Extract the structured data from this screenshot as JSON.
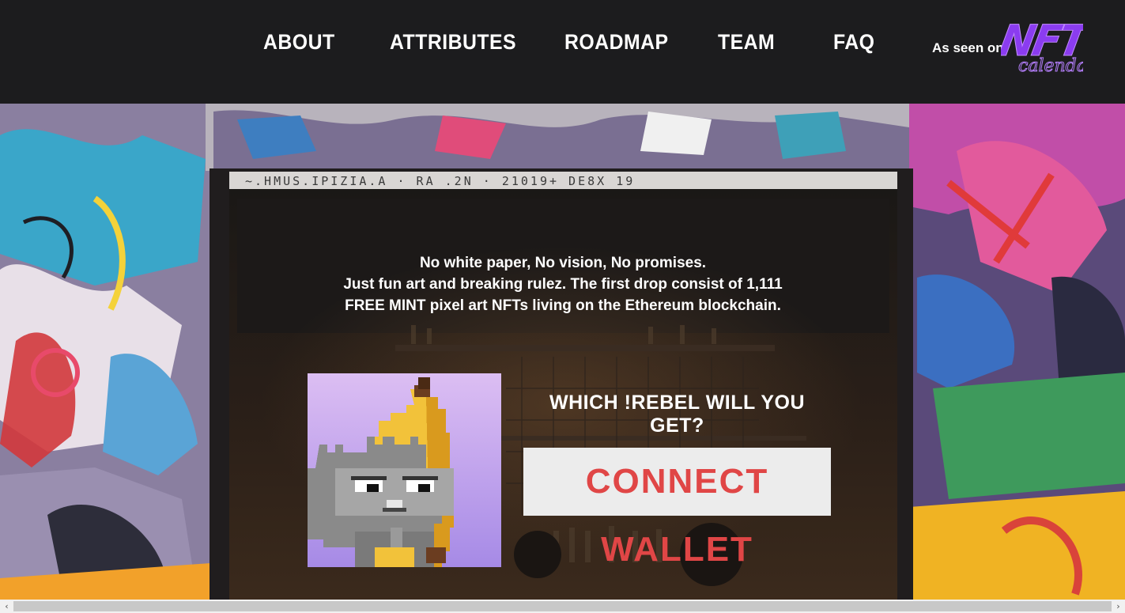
{
  "nav": {
    "items": [
      {
        "label": "ABOUT"
      },
      {
        "label": "ATTRIBUTES"
      },
      {
        "label": "ROADMAP"
      },
      {
        "label": "TEAM"
      },
      {
        "label": "FAQ"
      }
    ],
    "seen_on": "As seen on",
    "logo": {
      "big": "NFT",
      "script": "calendar",
      "color": "#8b3cf0"
    }
  },
  "hero": {
    "intro_lines": [
      "No white paper, No vision, No promises.",
      "Just fun art and breaking rulez. The first drop consist of 1,111",
      "FREE MINT pixel art NFTs living on the Ethereum blockchain."
    ],
    "question": "WHICH !REBEL WILL YOU GET?",
    "connect_label": "CONNECT WALLET",
    "nft_image": "pixel-cat-in-banana-costume"
  },
  "scrollbar": {
    "left_arrow": "‹",
    "right_arrow": "›"
  },
  "colors": {
    "topbar": "#1c1c1e",
    "connect_text": "#e04646",
    "connect_bg": "#ececec",
    "card_bg_top": "#d9b8f2",
    "card_bg_bottom": "#a389e8"
  }
}
